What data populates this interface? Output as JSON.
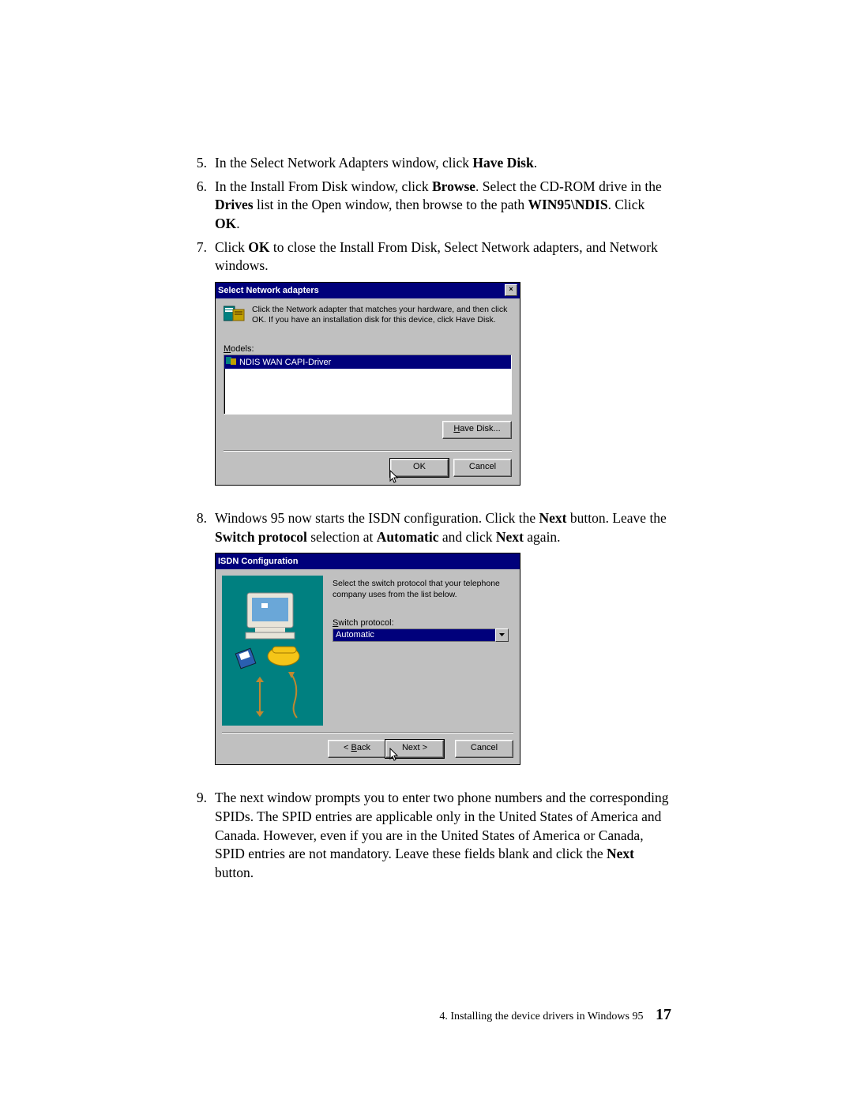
{
  "steps": {
    "s5": {
      "num": "5.",
      "a": "In the Select Network Adapters window, click ",
      "b": "Have Disk",
      "c": "."
    },
    "s6": {
      "num": "6.",
      "a": "In the Install From Disk window, click ",
      "b": "Browse",
      "c": ". Select the CD-ROM drive in the ",
      "d": "Drives",
      "e": " list in the Open window, then browse to the path ",
      "f": "WIN95\\NDIS",
      "g": ". Click ",
      "h": "OK",
      "i": "."
    },
    "s7": {
      "num": "7.",
      "a": "Click ",
      "b": "OK",
      "c": " to close the Install From Disk, Select Network adapters, and Network windows."
    },
    "s8": {
      "num": "8.",
      "a": "Windows 95 now starts the ISDN configuration. Click the ",
      "b": "Next",
      "c": " button. Leave the ",
      "d": "Switch protocol",
      "e": " selection at ",
      "f": "Automatic",
      "g": " and click ",
      "h": "Next",
      "i": " again."
    },
    "s9": {
      "num": "9.",
      "a": "The next window prompts you to enter two phone numbers and the corresponding SPIDs. The SPID entries are applicable only in the United States of America and Canada. However, even if you are in the United States of America or Canada, SPID entries are not mandatory. Leave these fields blank and click the ",
      "b": "Next",
      "c": " button."
    }
  },
  "dialog1": {
    "title": "Select Network adapters",
    "instruction": "Click the Network adapter that matches your hardware, and then click OK. If you have an installation disk for this device, click Have Disk.",
    "models_label": "Models:",
    "list_item": "NDIS WAN CAPI-Driver",
    "have_disk": "Have Disk...",
    "ok": "OK",
    "cancel": "Cancel"
  },
  "dialog2": {
    "title": "ISDN Configuration",
    "instruction": "Select the switch protocol that your telephone company uses from the list below.",
    "switch_label": "Switch protocol:",
    "switch_value": "Automatic",
    "back": "< Back",
    "next": "Next >",
    "cancel": "Cancel"
  },
  "footer": {
    "section": "4.   Installing the device drivers in Windows 95",
    "page": "17"
  }
}
